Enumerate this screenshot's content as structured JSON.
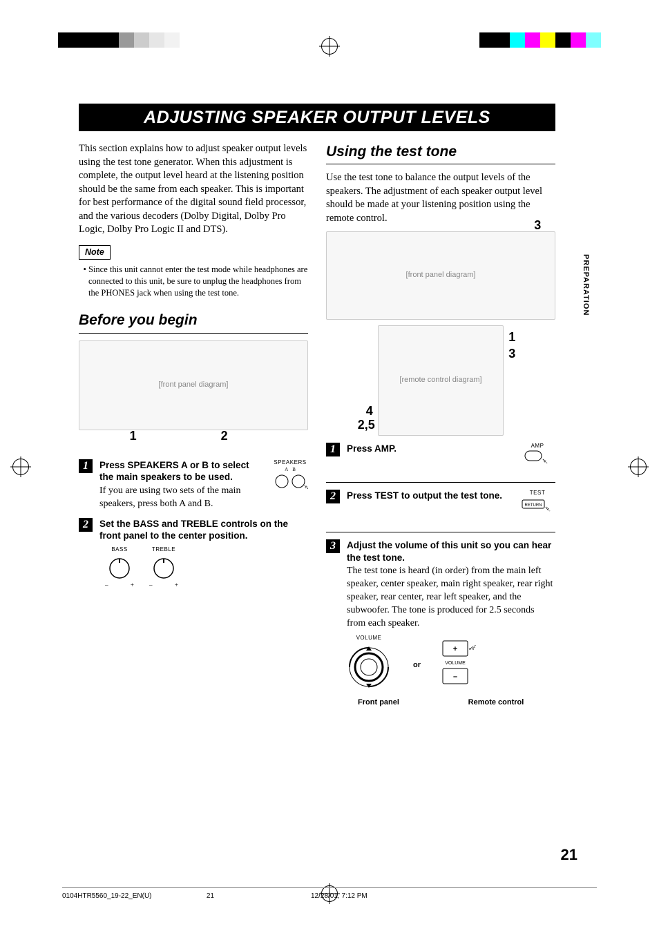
{
  "page_title": "ADJUSTING SPEAKER OUTPUT LEVELS",
  "intro": "This section explains how to adjust speaker output levels using the test tone generator. When this adjustment is complete, the output level heard at the listening position should be the same from each speaker. This is important for best performance of the digital sound field processor, and the various decoders (Dolby Digital, Dolby Pro Logic, Dolby Pro Logic II and DTS).",
  "note_label": "Note",
  "note_bullet": "Since this unit cannot enter the test mode while headphones are connected to this unit, be sure to unplug the headphones from the PHONES jack when using the test tone.",
  "section_left": "Before you begin",
  "left_diagram_callouts": {
    "one": "1",
    "two": "2"
  },
  "left_step1_title": "Press SPEAKERS A or B to select the main speakers to be used.",
  "left_step1_body": "If you are using two sets of the main speakers, press both A and B.",
  "left_step1_icon_label": "SPEAKERS",
  "left_step1_icon_a": "A",
  "left_step1_icon_b": "B",
  "left_step2_title": "Set the BASS and TREBLE controls on the front panel to the center position.",
  "knob_bass": "BASS",
  "knob_treble": "TREBLE",
  "knob_minus": "–",
  "knob_plus": "+",
  "section_right": "Using the test tone",
  "right_intro": "Use the test tone to balance the output levels of the speakers. The adjustment of each speaker output level should be made at your listening position using the remote control.",
  "right_diagram_callouts": {
    "c3a": "3",
    "c1": "1",
    "c3b": "3",
    "c4": "4",
    "c25": "2,5"
  },
  "right_step1_title": "Press AMP.",
  "right_step1_icon": "AMP",
  "right_step2_title": "Press TEST to output the test tone.",
  "right_step2_icon_top": "TEST",
  "right_step2_icon_btn": "RETURN",
  "right_step3_title": "Adjust the volume of this unit so you can hear the test tone.",
  "right_step3_body": "The test tone is heard (in order) from the main left speaker, center speaker, main right speaker, rear right speaker, rear center, rear left speaker, and the subwoofer. The tone is produced for 2.5 seconds from each speaker.",
  "vol_knob_label": "VOLUME",
  "vol_or": "or",
  "vol_remote_plus": "+",
  "vol_remote_label": "VOLUME",
  "vol_remote_minus": "–",
  "caption_front": "Front panel",
  "caption_remote": "Remote control",
  "side_tab": "PREPARATION",
  "page_number": "21",
  "footer_filename": "0104HTR5560_19-22_EN(U)",
  "footer_page": "21",
  "footer_timestamp": "12/28/01, 7:12 PM"
}
